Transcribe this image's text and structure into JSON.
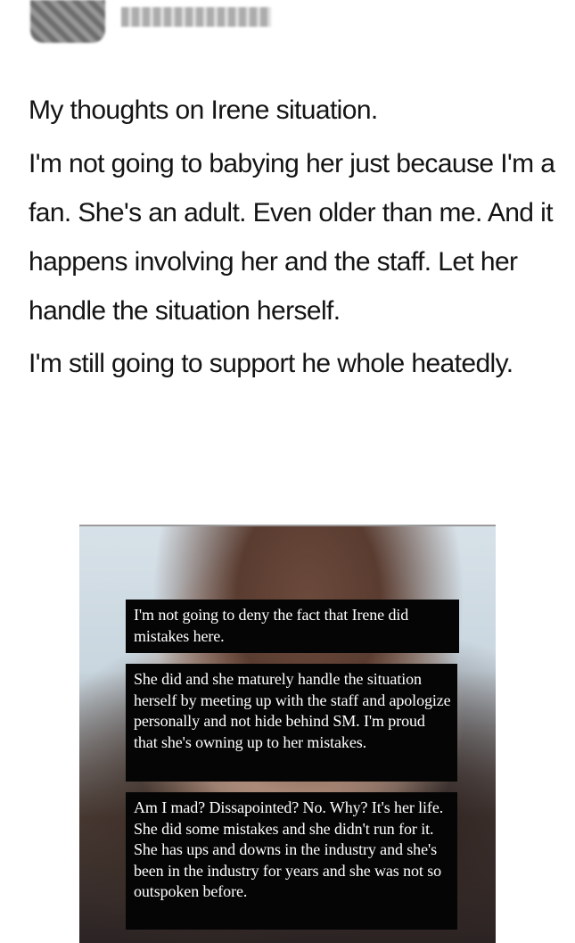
{
  "header": {
    "avatar_icon": "blurred-avatar",
    "handle_icon": "blurred-username"
  },
  "tweet": {
    "paragraphs": [
      "My thoughts on Irene situation.",
      "I'm not going to babying her just because I'm a fan. She's an adult. Even older than me. And it happens involving her and the staff. Let her handle the situation herself.",
      "I'm still going to support he whole heatedly."
    ]
  },
  "media": {
    "captions": [
      "I'm not going to deny the fact that Irene did mistakes here.",
      "She did and she maturely handle the situation herself by meeting up with the staff and apologize personally and not hide behind SM. I'm proud that she's owning up to her mistakes.",
      "Am I mad? Dissapointed? No. Why? It's her life. She did some mistakes and she didn't run for it. She has ups and downs in the industry and she's been in the industry for years and she was not so outspoken before."
    ]
  }
}
